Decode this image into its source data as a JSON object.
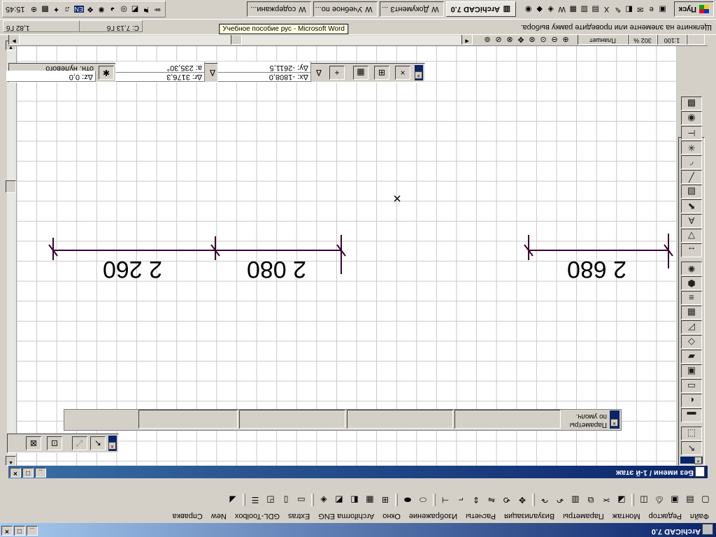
{
  "app": {
    "title": "ArchiCAD 7.0",
    "doc_title": "Без имени / 1-й этаж"
  },
  "menu": [
    "Файл",
    "Редактор",
    "Монтаж",
    "Параметры",
    "Визуализация",
    "Расчеты",
    "Изображение",
    "Окно",
    "Archiforma ENG",
    "Extras",
    "GDL-Toolbox",
    "New",
    "Справка"
  ],
  "status": {
    "hint": "Щелкните на элементе или проведите рамку выбора.",
    "memory1": "С: 7,13 Гб",
    "memory2": "1,82 Гб",
    "tooltip": "Учебное пособие рус - Microsoft Word"
  },
  "viewbar": {
    "scale": "1:100",
    "zoom": "302 %",
    "layer": "Планшет"
  },
  "coords": {
    "dx": "Δx: -1808,0",
    "dy": "Δy: -2611,5",
    "dr": "Δr: 3176,3",
    "a": "a: 235,30°",
    "dz": "Δz: 0,0",
    "ref": "отн. нулевого"
  },
  "info_palette": {
    "label1": "Параметры",
    "label2": "по умолч."
  },
  "dimensions": [
    "2 680",
    "2 080",
    "2 260"
  ],
  "taskbar": {
    "start": "Пуск",
    "clock": "15:45",
    "lang": "EN",
    "buttons": [
      "ArchiCAD 7.0",
      "Документ3 ...",
      "Учебное по...",
      "содержани..."
    ]
  },
  "toolbox_icons": [
    "arrow-icon",
    "marquee-icon",
    "wall-icon",
    "door-icon",
    "window-icon",
    "column-icon",
    "beam-icon",
    "slab-icon",
    "roof-icon",
    "mesh-icon",
    "stair-icon",
    "object-icon",
    "lamp-icon",
    "dimension-icon",
    "level-dim-icon",
    "text-icon",
    "label-icon",
    "fill-icon",
    "line-icon",
    "arc-icon",
    "hotspot-icon",
    "section-icon",
    "camera-icon",
    "figure-icon"
  ]
}
